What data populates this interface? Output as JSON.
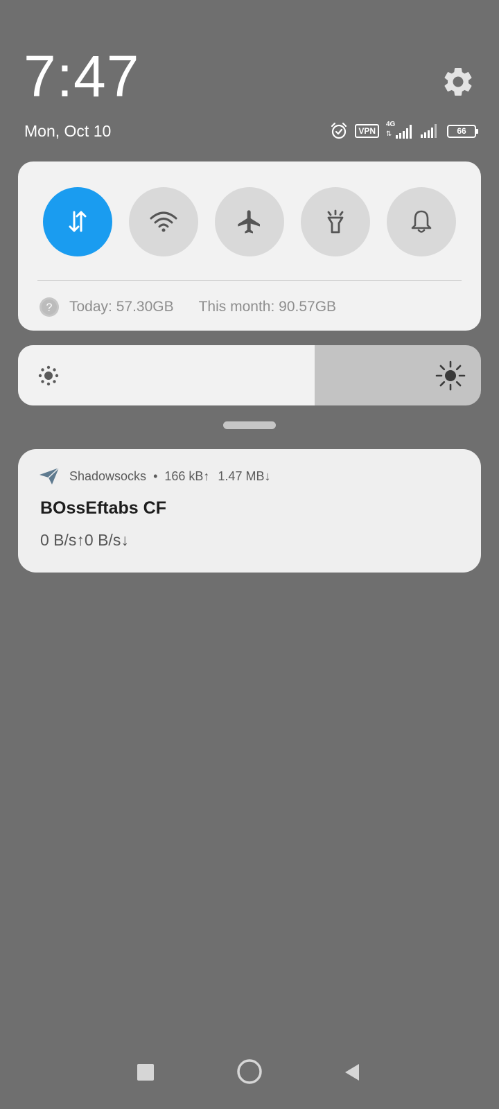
{
  "header": {
    "time": "7:47",
    "date": "Mon, Oct 10",
    "status_icons": [
      "alarm-icon",
      "vpn-icon",
      "signal-4g-icon",
      "signal-icon",
      "battery-icon"
    ],
    "network_label": "4G",
    "vpn_label": "VPN",
    "battery_level": "66"
  },
  "quick_settings": {
    "toggles": [
      {
        "name": "mobile-data",
        "icon": "data-transfer-icon",
        "active": true
      },
      {
        "name": "wifi",
        "icon": "wifi-icon",
        "active": false
      },
      {
        "name": "airplane-mode",
        "icon": "airplane-icon",
        "active": false
      },
      {
        "name": "flashlight",
        "icon": "flashlight-icon",
        "active": false
      },
      {
        "name": "sound",
        "icon": "bell-icon",
        "active": false
      }
    ],
    "usage_today": "Today: 57.30GB",
    "usage_month": "This month: 90.57GB"
  },
  "brightness": {
    "level_percent": 64
  },
  "notification": {
    "app_name": "Shadowsocks",
    "separator": "•",
    "upload": "166 kB↑",
    "download": "1.47 MB↓",
    "title": "BOssEftabs CF",
    "body": "0 B/s↑0 B/s↓"
  },
  "nav": {
    "buttons": [
      "recents-button",
      "home-button",
      "back-button"
    ]
  },
  "colors": {
    "background": "#6f6f6f",
    "panel": "#f2f2f2",
    "accent": "#1a9cf0",
    "toggle_inactive": "#d9d9d9",
    "brightness_track": "#c3c3c3"
  }
}
